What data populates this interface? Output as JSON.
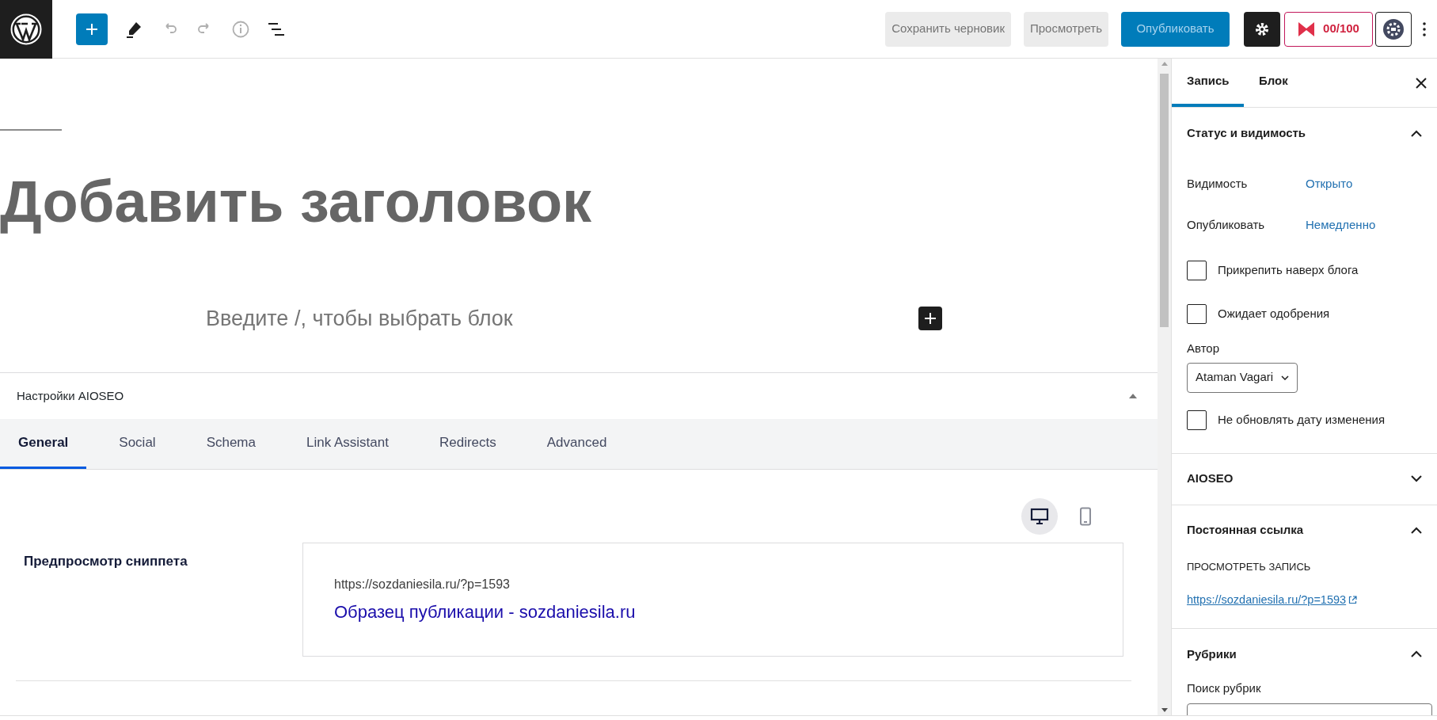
{
  "toolbar": {
    "left_buttons": [
      {
        "kind": "add",
        "selected": true
      },
      {
        "kind": "edit",
        "disabled": false
      },
      {
        "kind": "undo",
        "disabled": true
      },
      {
        "kind": "redo",
        "disabled": true
      },
      {
        "kind": "info",
        "disabled": true
      },
      {
        "kind": "list",
        "disabled": false
      }
    ],
    "save_draft": "Сохранить черновик",
    "preview": "Просмотреть",
    "publish": "Опубликовать",
    "seo_score": "00/100"
  },
  "editor": {
    "title_placeholder": "Добавить заголовок",
    "block_placeholder": "Введите /, чтобы выбрать блок"
  },
  "aioseo": {
    "title": "Настройки AIOSEO",
    "expanded": true,
    "tabs": [
      {
        "label": "General",
        "selected": true
      },
      {
        "label": "Social",
        "selected": false
      },
      {
        "label": "Schema",
        "selected": false
      },
      {
        "label": "Link Assistant",
        "selected": false
      },
      {
        "label": "Redirects",
        "selected": false
      },
      {
        "label": "Advanced",
        "selected": false
      }
    ],
    "devices": [
      {
        "kind": "desktop",
        "selected": true
      },
      {
        "kind": "mobile",
        "selected": false
      }
    ],
    "snippet_label": "Предпросмотр сниппета",
    "snippet_url": "https://sozdaniesila.ru/?p=1593",
    "snippet_title": "Образец публикации - sozdaniesila.ru"
  },
  "sidebar": {
    "tabs": [
      {
        "label": "Запись",
        "selected": true
      },
      {
        "label": "Блок",
        "selected": false
      }
    ],
    "status": {
      "title": "Статус и видимость",
      "expanded": true,
      "rows": [
        {
          "label": "Видимость",
          "value": "Открыто"
        },
        {
          "label": "Опубликовать",
          "value": "Немедленно"
        }
      ],
      "checks": [
        {
          "label": "Прикрепить наверх блога",
          "checked": false
        },
        {
          "label": "Ожидает одобрения",
          "checked": false
        }
      ],
      "author_label": "Автор",
      "author": "Ataman Vagari",
      "checks_after": [
        {
          "label": "Не обновлять дату изменения",
          "checked": false
        }
      ]
    },
    "aioseo": {
      "title": "AIOSEO",
      "expanded": false
    },
    "permalink": {
      "title": "Постоянная ссылка",
      "expanded": true,
      "view_label": "ПРОСМОТРЕТЬ ЗАПИСЬ",
      "url": "https://sozdaniesila.ru/?p=1593"
    },
    "categories": {
      "title": "Рубрики",
      "expanded": true,
      "search_label": "Поиск рубрик"
    }
  }
}
